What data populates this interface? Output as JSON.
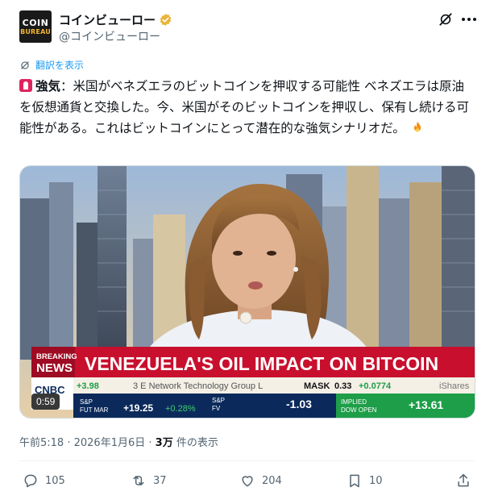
{
  "author": {
    "display_name": "コインビューロー",
    "handle": "@コインビューロー",
    "avatar_line1": "COIN",
    "avatar_line2": "BUREAU",
    "verified_color": "#e8b43a"
  },
  "translate_label": "翻訳を表示",
  "tweet": {
    "keyword": "強気",
    "body": "：米国がベネズエラのビットコインを押収する可能性 ベネズエラは原油を仮想通貨と交換した。今、米国がそのビットコインを押収し、保有し続ける可能性がある。これはビットコインにとって潜在的な強気シナリオだ。",
    "lead_icon": "siren-icon",
    "trail_icon": "fire-icon"
  },
  "video": {
    "duration": "0:59",
    "breaking_label_1": "BREAKING",
    "breaking_label_2": "NEWS",
    "headline": "VENEZUELA'S OIL IMPACT ON BITCOIN",
    "network": "CNBC",
    "ticker_row1": {
      "first": "+3.98",
      "company": "3 E Network Technology Group L",
      "symbol": "MASK",
      "price": "0.33",
      "change": "+0.0774",
      "last": "iShares"
    },
    "ticker_row2": {
      "sp_label_1": "S&P",
      "sp_label_2": "FUT MAR",
      "sp_value": "+19.25",
      "sp_pct": "+0.28%",
      "fv_label_1": "S&P",
      "fv_label_2": "FV",
      "fv_value": "-1.03",
      "dow_label_1": "IMPLIED",
      "dow_label_2": "DOW OPEN",
      "dow_value": "+13.61"
    },
    "colors": {
      "banner_red": "#c8102e",
      "positive_green": "#1e9e48",
      "ticker_navy": "#0b2a5b"
    }
  },
  "meta": {
    "time": "午前5:18",
    "separator": " · ",
    "date": "2026年1月6日",
    "views_count": "3万",
    "views_label": " 件の表示"
  },
  "actions": {
    "replies": "105",
    "reposts": "37",
    "likes": "204",
    "bookmarks": "10"
  }
}
